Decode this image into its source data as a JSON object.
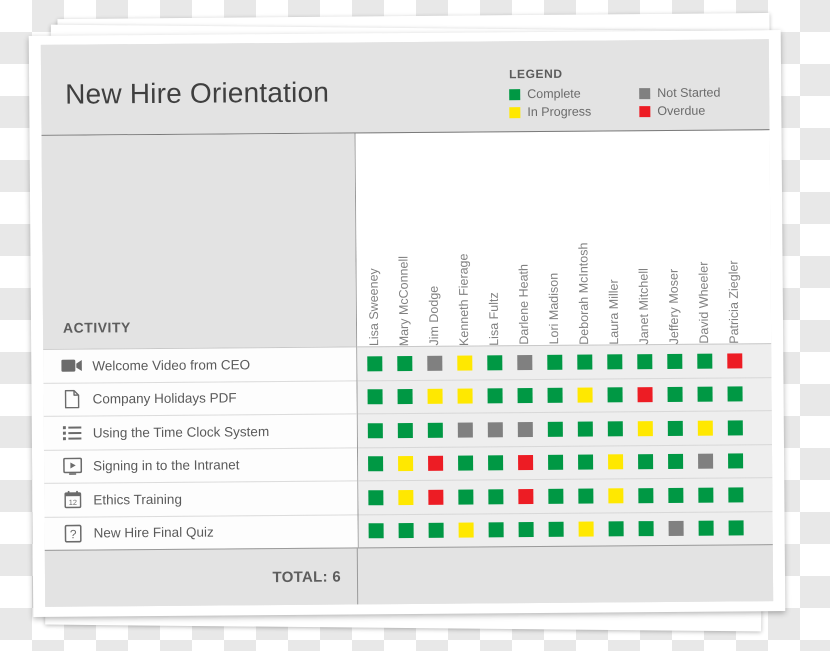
{
  "document": {
    "title": "New Hire Orientation",
    "activity_header": "ACTIVITY",
    "total_label": "TOTAL: 6"
  },
  "legend": {
    "title": "LEGEND",
    "items": [
      {
        "label": "Complete",
        "color": "#009844",
        "key": "complete"
      },
      {
        "label": "Not Started",
        "color": "#808080",
        "key": "not_started"
      },
      {
        "label": "In Progress",
        "color": "#ffe800",
        "key": "in_progress"
      },
      {
        "label": "Overdue",
        "color": "#ed1c24",
        "key": "overdue"
      }
    ]
  },
  "status_colors": {
    "complete": "#009844",
    "in_progress": "#ffe800",
    "not_started": "#808080",
    "overdue": "#ed1c24"
  },
  "people": [
    "Lisa Sweeney",
    "Mary McConnell",
    "Jim Dodge",
    "Kenneth Fierage",
    "Lisa Fultz",
    "Darlene Heath",
    "Lori Madison",
    "Deborah McIntosh",
    "Laura Miller",
    "Janet Mitchell",
    "Jeffery Moser",
    "David Wheeler",
    "Patricia Ziegler"
  ],
  "activities": [
    {
      "label": "Welcome Video from CEO",
      "icon": "video-camera-icon",
      "statuses": [
        "complete",
        "complete",
        "not_started",
        "in_progress",
        "complete",
        "not_started",
        "complete",
        "complete",
        "complete",
        "complete",
        "complete",
        "complete",
        "overdue"
      ]
    },
    {
      "label": "Company Holidays PDF",
      "icon": "document-page-icon",
      "statuses": [
        "complete",
        "complete",
        "in_progress",
        "in_progress",
        "complete",
        "complete",
        "complete",
        "in_progress",
        "complete",
        "overdue",
        "complete",
        "complete",
        "complete"
      ]
    },
    {
      "label": "Using the Time Clock System",
      "icon": "bullet-list-icon",
      "statuses": [
        "complete",
        "complete",
        "complete",
        "not_started",
        "not_started",
        "not_started",
        "complete",
        "complete",
        "complete",
        "in_progress",
        "complete",
        "in_progress",
        "complete"
      ]
    },
    {
      "label": "Signing in to the Intranet",
      "icon": "monitor-play-icon",
      "statuses": [
        "complete",
        "in_progress",
        "overdue",
        "complete",
        "complete",
        "overdue",
        "complete",
        "complete",
        "in_progress",
        "complete",
        "complete",
        "not_started",
        "complete"
      ]
    },
    {
      "label": "Ethics Training",
      "icon": "calendar-icon",
      "statuses": [
        "complete",
        "in_progress",
        "overdue",
        "complete",
        "complete",
        "overdue",
        "complete",
        "complete",
        "in_progress",
        "complete",
        "complete",
        "complete",
        "complete"
      ]
    },
    {
      "label": "New Hire Final Quiz",
      "icon": "question-box-icon",
      "statuses": [
        "complete",
        "complete",
        "complete",
        "in_progress",
        "complete",
        "complete",
        "complete",
        "in_progress",
        "complete",
        "complete",
        "not_started",
        "complete",
        "complete"
      ]
    }
  ]
}
